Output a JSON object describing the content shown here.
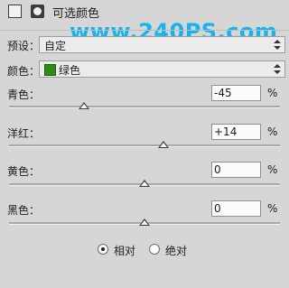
{
  "panel": {
    "title": "可选颜色",
    "watermark": "www.240PS.com"
  },
  "preset": {
    "label": "预设：",
    "value": "自定"
  },
  "colors": {
    "label": "颜色：",
    "value": "绿色",
    "swatch_color": "#2e8b14"
  },
  "sliders": [
    {
      "label": "青色：",
      "value": "-45",
      "unit": "%",
      "level": -45
    },
    {
      "label": "洋红：",
      "value": "+14",
      "unit": "%",
      "level": 14
    },
    {
      "label": "黄色：",
      "value": "0",
      "unit": "%",
      "level": 0
    },
    {
      "label": "黑色：",
      "value": "0",
      "unit": "%",
      "level": 0
    }
  ],
  "method": {
    "options": [
      {
        "label": "相对",
        "selected": true
      },
      {
        "label": "绝对",
        "selected": false
      }
    ]
  }
}
